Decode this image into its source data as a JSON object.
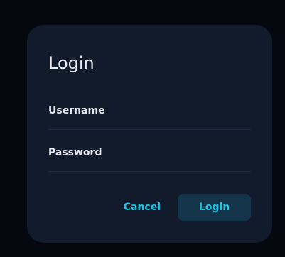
{
  "dialog": {
    "title": "Login",
    "fields": {
      "username": {
        "label": "Username",
        "value": ""
      },
      "password": {
        "label": "Password",
        "value": ""
      }
    },
    "buttons": {
      "cancel": "Cancel",
      "login": "Login"
    }
  },
  "colors": {
    "backdrop": "#05080f",
    "dialog_bg": "#121b2b",
    "accent": "#20c3e4",
    "primary_button_bg": "#14344a",
    "text": "#e8ecf2",
    "divider": "#1f2b3d"
  }
}
